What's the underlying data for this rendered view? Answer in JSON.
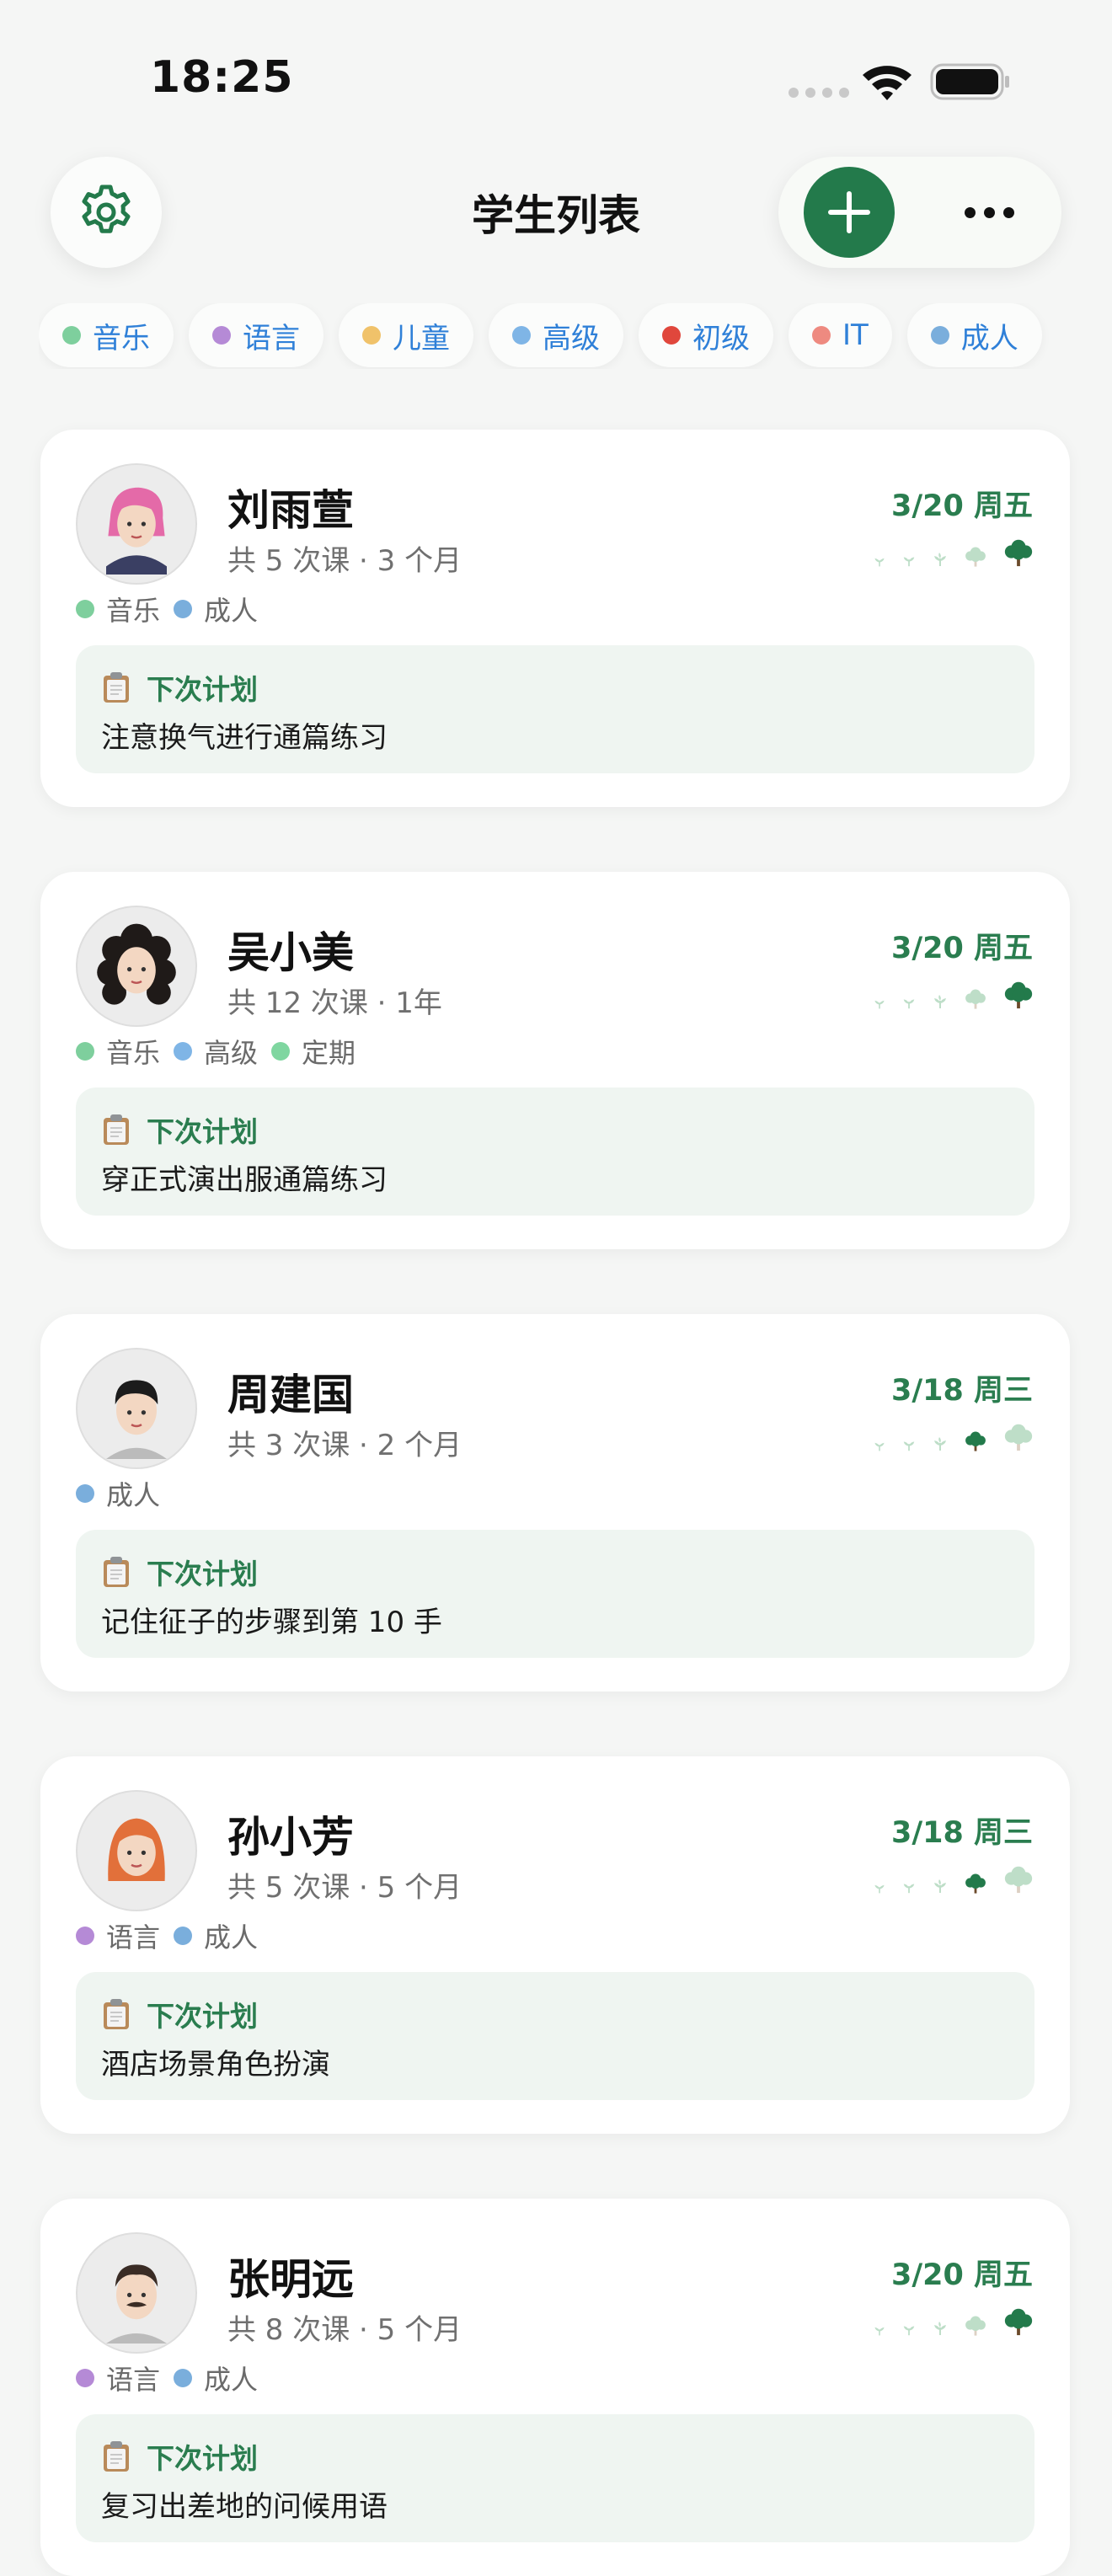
{
  "status_bar": {
    "time": "18:25"
  },
  "header": {
    "title": "学生列表"
  },
  "colors": {
    "accent_green": "#237a4b",
    "chip_text": "#2f80d8",
    "tag_music": "#7ecf9d",
    "tag_language": "#b58ad6",
    "tag_child": "#f0c26a",
    "tag_advanced": "#7fb5e6",
    "tag_beginner": "#e0473c",
    "tag_it": "#ee8a80",
    "tag_adult": "#7aaedc",
    "tag_regular": "#7fd6a0"
  },
  "filters": [
    {
      "label": "音乐",
      "color": "#7ecf9d"
    },
    {
      "label": "语言",
      "color": "#b58ad6"
    },
    {
      "label": "儿童",
      "color": "#f0c26a"
    },
    {
      "label": "高级",
      "color": "#7fb5e6"
    },
    {
      "label": "初级",
      "color": "#e0473c"
    },
    {
      "label": "IT",
      "color": "#ee8a80"
    },
    {
      "label": "成人",
      "color": "#7aaedc"
    }
  ],
  "plan_label": "下次计划",
  "students": [
    {
      "name": "刘雨萱",
      "meta": "共 5 次课 · 3 个月",
      "date": "3/20 周五",
      "avatar": "pink-hair-woman-avatar",
      "growth_level": 5,
      "tags": [
        {
          "label": "音乐",
          "color": "#7ecf9d"
        },
        {
          "label": "成人",
          "color": "#7aaedc"
        }
      ],
      "plan": "注意换气进行通篇练习"
    },
    {
      "name": "吴小美",
      "meta": "共 12 次课 · 1年",
      "date": "3/20 周五",
      "avatar": "curly-hair-woman-avatar",
      "growth_level": 5,
      "tags": [
        {
          "label": "音乐",
          "color": "#7ecf9d"
        },
        {
          "label": "高级",
          "color": "#7fb5e6"
        },
        {
          "label": "定期",
          "color": "#7fd6a0"
        }
      ],
      "plan": "穿正式演出服通篇练习"
    },
    {
      "name": "周建国",
      "meta": "共 3 次课 · 2 个月",
      "date": "3/18 周三",
      "avatar": "young-man-avatar",
      "growth_level": 4,
      "tags": [
        {
          "label": "成人",
          "color": "#7aaedc"
        }
      ],
      "plan": "记住征子的步骤到第 10 手"
    },
    {
      "name": "孙小芳",
      "meta": "共 5 次课 · 5 个月",
      "date": "3/18 周三",
      "avatar": "red-hair-woman-avatar",
      "growth_level": 4,
      "tags": [
        {
          "label": "语言",
          "color": "#b58ad6"
        },
        {
          "label": "成人",
          "color": "#7aaedc"
        }
      ],
      "plan": "酒店场景角色扮演"
    },
    {
      "name": "张明远",
      "meta": "共 8 次课 · 5 个月",
      "date": "3/20 周五",
      "avatar": "mustache-man-avatar",
      "growth_level": 5,
      "tags": [
        {
          "label": "语言",
          "color": "#b58ad6"
        },
        {
          "label": "成人",
          "color": "#7aaedc"
        }
      ],
      "plan": "复习出差地的问候用语"
    }
  ]
}
